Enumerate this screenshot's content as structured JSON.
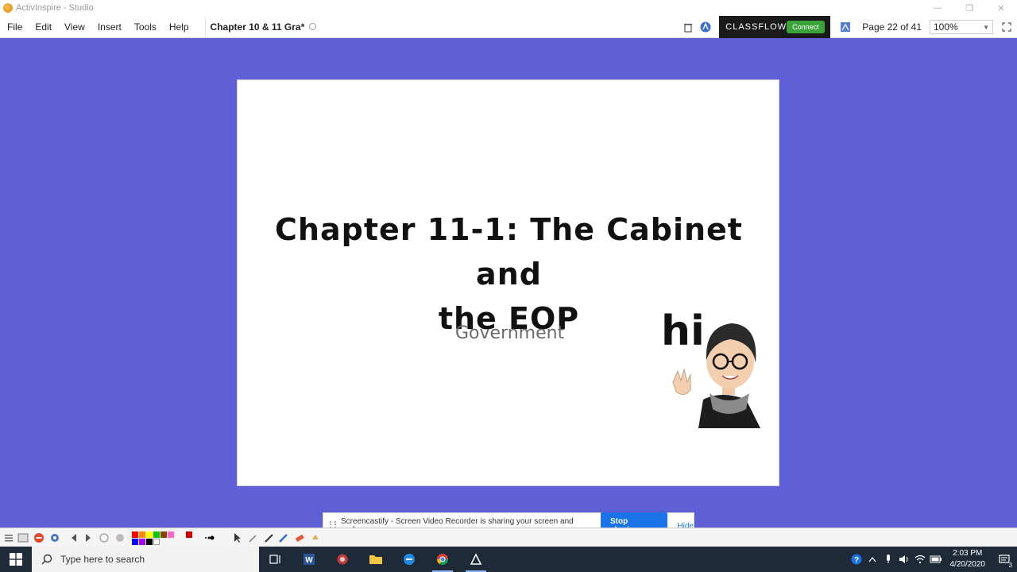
{
  "window": {
    "title": "ActivInspire - Studio",
    "controls": [
      "—",
      "❐",
      "✕"
    ]
  },
  "menu": {
    "items": [
      "File",
      "Edit",
      "View",
      "Insert",
      "Tools",
      "Help"
    ],
    "doc_tab": "Chapter 10 & 11 Gra*"
  },
  "toolbar_right": {
    "classflow_label": "CLASSFLOW",
    "connect_label": "Connect",
    "page_indicator": "Page 22 of 41",
    "zoom": "100%"
  },
  "slide": {
    "title_line1": "Chapter 11-1:  The Cabinet and",
    "title_line2": "the EOP",
    "subtitle": "Government",
    "sticker_text": "hi"
  },
  "screencastify": {
    "message": "Screencastify - Screen Video Recorder is sharing your screen and audio.",
    "stop_label": "Stop sharing",
    "hide_label": "Hide"
  },
  "taskbar": {
    "search_placeholder": "Type here to search",
    "time": "2:03 PM",
    "date": "4/20/2020",
    "notification_count": "3"
  },
  "colors": {
    "canvas_bg": "#5f5fd6",
    "taskbar_bg": "#1e2a38",
    "stop_button": "#1a73e8",
    "connect_button": "#3aa33a"
  },
  "palette": [
    "#ff0000",
    "#ff8800",
    "#ffff00",
    "#00cc00",
    "#0000ff",
    "#aa00ff",
    "#ff66cc",
    "#000000",
    "#ffffff",
    "#884400",
    "#cc0000"
  ]
}
